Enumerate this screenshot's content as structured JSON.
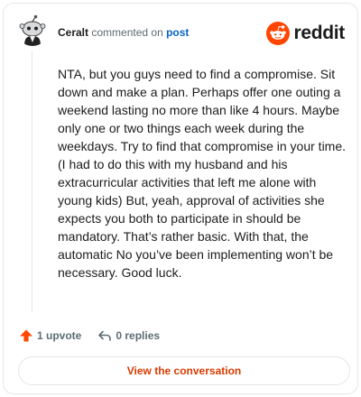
{
  "header": {
    "author": "Ceralt",
    "action_text": "commented on",
    "post_link": "post",
    "brand": "reddit"
  },
  "comment": {
    "body": "NTA, but you guys need to find a compromise. Sit down and make a plan. Perhaps offer one outing a weekend lasting no more than like 4 hours. Maybe only one or two things each week during the weekdays. Try to find that compromise in your time. (I had to do this with my husband and his extracurricular activities that left me alone with young kids) But, yeah, approval of activities she expects you both to participate in should be mandatory. That’s rather basic. With that, the automatic No you’ve been implementing won’t be necessary. Good luck."
  },
  "actions": {
    "upvote_label": "1 upvote",
    "replies_label": "0 replies",
    "view_conversation": "View the conversation"
  },
  "colors": {
    "brand": "#ff4500",
    "link": "#0a66c2",
    "cta_text": "#d93a00",
    "muted": "#5c6c74",
    "border": "#e4e6e8"
  },
  "icons": {
    "avatar": "snoo-avatar-icon",
    "brand": "reddit-logo-icon",
    "upvote": "upvote-arrow-icon",
    "reply": "reply-arrow-icon"
  }
}
